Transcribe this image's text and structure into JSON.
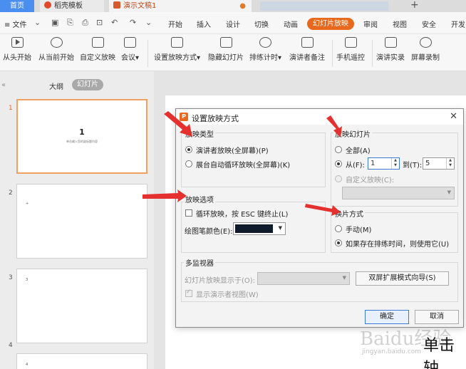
{
  "tabs": {
    "home": "首页",
    "shell": "稻壳模板",
    "doc": "演示文稿1",
    "doc_modified": "●",
    "new_tab": "+"
  },
  "menubar": {
    "file": "≡ 文件",
    "items": [
      "开始",
      "插入",
      "设计",
      "切换",
      "动画",
      "幻灯片放映",
      "审阅",
      "视图",
      "安全",
      "开发"
    ],
    "active": "幻灯片放映"
  },
  "toolbar": {
    "items": [
      "从头开始",
      "从当前开始",
      "自定义放映",
      "会议",
      "设置放映方式",
      "隐藏幻灯片",
      "排练计时",
      "演讲者备注",
      "手机遥控",
      "演讲实录",
      "屏幕录制"
    ]
  },
  "leftpanel": {
    "collapse": "«",
    "outline": "大纲",
    "slides": "幻灯片",
    "thumbs": [
      {
        "num": "1",
        "title": "1",
        "subtitle": "单击输入您的副标题内容",
        "mark": ""
      },
      {
        "num": "2",
        "title": "",
        "subtitle": "",
        "mark": "+"
      },
      {
        "num": "3",
        "title": "",
        "subtitle": "",
        "mark": "3"
      },
      {
        "num": "4",
        "title": "",
        "subtitle": "",
        "mark": "4"
      }
    ]
  },
  "canvas": {
    "text": "单击轴",
    "watermark": "Baidu经验",
    "watermark_url": "jingyan.baidu.com"
  },
  "dialog": {
    "title": "设置放映方式",
    "show_type": {
      "label": "放映类型",
      "opt1": "演讲者放映(全屏幕)(P)",
      "opt2": "展台自动循环放映(全屏幕)(K)"
    },
    "show_slides": {
      "label": "放映幻灯片",
      "all": "全部(A)",
      "from": "从(F):",
      "from_value": "1",
      "to": "到(T):",
      "to_value": "5",
      "custom": "自定义放映(C):"
    },
    "show_options": {
      "label": "放映选项",
      "loop": "循环放映，按 ESC 键终止(L)",
      "pen_color": "绘图笔颜色(E):",
      "pen_color_value": "#0f1a2a"
    },
    "advance": {
      "label": "换片方式",
      "manual": "手动(M)",
      "timings": "如果存在排练时间，则使用它(U)"
    },
    "monitors": {
      "label": "多监视器",
      "display_on": "幻灯片放映显示于(O):",
      "dual_wizard": "双屏扩展模式向导(S)",
      "presenter_view": "显示演示者视图(W)"
    },
    "ok": "确定",
    "cancel": "取消"
  }
}
